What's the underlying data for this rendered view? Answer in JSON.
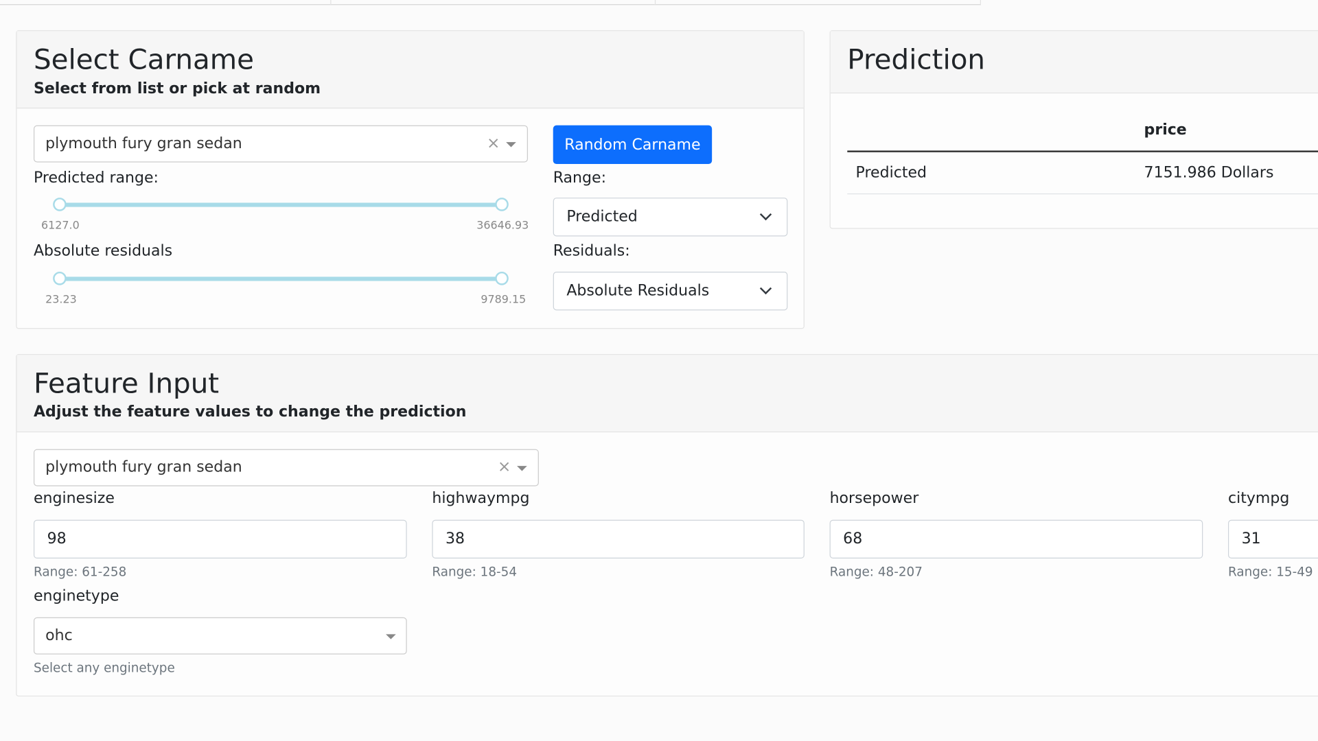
{
  "select_carname": {
    "title": "Select Carname",
    "subtitle": "Select from list or pick at random",
    "selected_car": "plymouth fury gran sedan",
    "random_button": "Random Carname",
    "predicted_range": {
      "label": "Predicted range:",
      "min": "6127.0",
      "max": "36646.93"
    },
    "absolute_residuals": {
      "label": "Absolute residuals",
      "min": "23.23",
      "max": "9789.15"
    },
    "range_label": "Range:",
    "range_value": "Predicted",
    "residuals_label": "Residuals:",
    "residuals_value": "Absolute Residuals"
  },
  "prediction": {
    "title": "Prediction",
    "columns": [
      "",
      "price"
    ],
    "rows": [
      [
        "Predicted",
        "7151.986 Dollars"
      ]
    ]
  },
  "feature_input": {
    "title": "Feature Input",
    "subtitle": "Adjust the feature values to change the prediction",
    "selected_car": "plymouth fury gran sedan",
    "features": [
      {
        "name": "enginesize",
        "value": "98",
        "range": "Range: 61-258"
      },
      {
        "name": "highwaympg",
        "value": "38",
        "range": "Range: 18-54"
      },
      {
        "name": "horsepower",
        "value": "68",
        "range": "Range: 48-207"
      },
      {
        "name": "citympg",
        "value": "31",
        "range": "Range: 15-49"
      }
    ],
    "enginetype": {
      "label": "enginetype",
      "value": "ohc",
      "hint": "Select any enginetype"
    }
  }
}
